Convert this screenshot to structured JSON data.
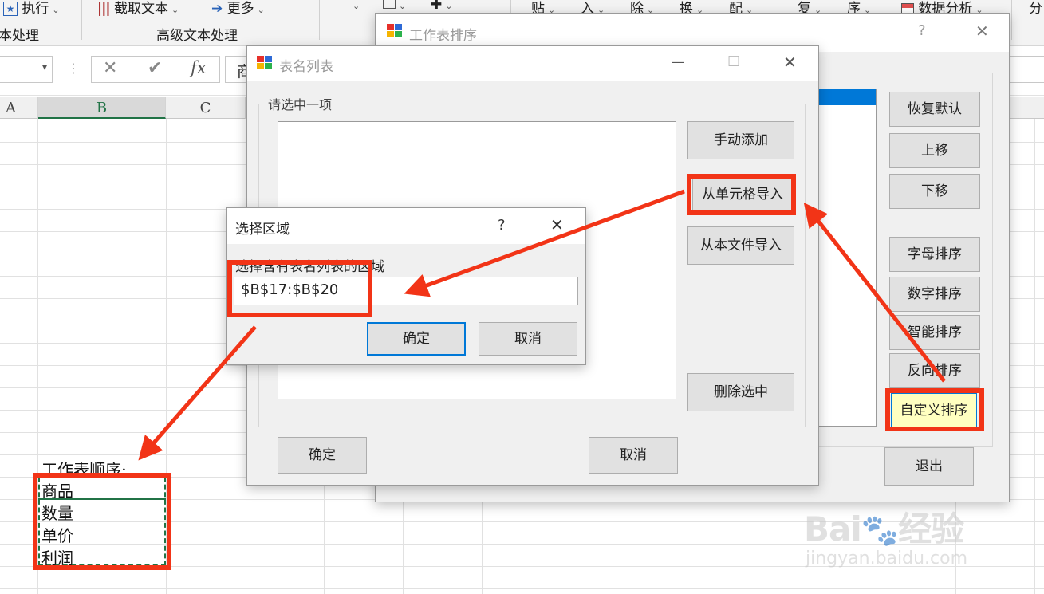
{
  "ribbon": {
    "buttons": [
      "执行",
      "截取文本",
      "更多",
      "贴",
      "入",
      "除",
      "换",
      "配",
      "复",
      "序",
      "数据分析",
      "分"
    ],
    "groups": [
      "本处理",
      "高级文本处理"
    ]
  },
  "formula_bar": {
    "cancel_icon": "✕",
    "enter_icon": "✔",
    "fx_label": "fx",
    "content": "商"
  },
  "columns": [
    "A",
    "B",
    "C"
  ],
  "cells": {
    "label": "工作表顺序:",
    "items": [
      "商品",
      "数量",
      "单价",
      "利润"
    ]
  },
  "sort_window": {
    "title": "工作表排序",
    "help": "?",
    "close": "✕",
    "buttons": [
      "恢复默认",
      "上移",
      "下移",
      "字母排序",
      "数字排序",
      "智能排序",
      "反向排序",
      "自定义排序",
      "退出"
    ]
  },
  "list_window": {
    "title": "表名列表",
    "minimize": "—",
    "maximize": "☐",
    "close": "✕",
    "group_label": "请选中一项",
    "buttons": [
      "手动添加",
      "从单元格导入",
      "从本文件导入",
      "删除选中"
    ],
    "ok": "确定",
    "cancel": "取消"
  },
  "range_dialog": {
    "title": "选择区域",
    "help": "?",
    "close": "✕",
    "prompt": "选择含有表名列表的区域",
    "value": "$B$17:$B$20",
    "ok": "确定",
    "cancel": "取消"
  },
  "watermark": {
    "brand": "Bai",
    "brand_suffix": "经验",
    "url": "jingyan.baidu.com"
  },
  "colors": {
    "annotation": "#f23417",
    "selection": "#0078d7",
    "highlight": "#ffffc0"
  }
}
